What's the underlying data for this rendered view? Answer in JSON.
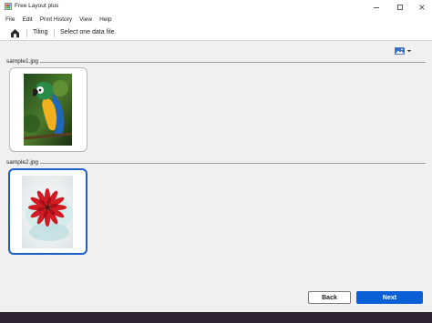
{
  "window": {
    "title": "Free Layout plus"
  },
  "menu": {
    "items": [
      "File",
      "Edit",
      "Print History",
      "View",
      "Help"
    ]
  },
  "toolbar": {
    "mode_label": "Tiling",
    "instruction": "Select one data file."
  },
  "groups": [
    {
      "name": "sample1.jpg",
      "selected": false,
      "image": "parrot-photo"
    },
    {
      "name": "sample2.jpg",
      "selected": true,
      "image": "red-flower-photo"
    }
  ],
  "footer": {
    "back_label": "Back",
    "next_label": "Next"
  },
  "colors": {
    "accent": "#0b5fd6",
    "selection_border": "#1d5fc9",
    "background": "#f0f0f0"
  }
}
